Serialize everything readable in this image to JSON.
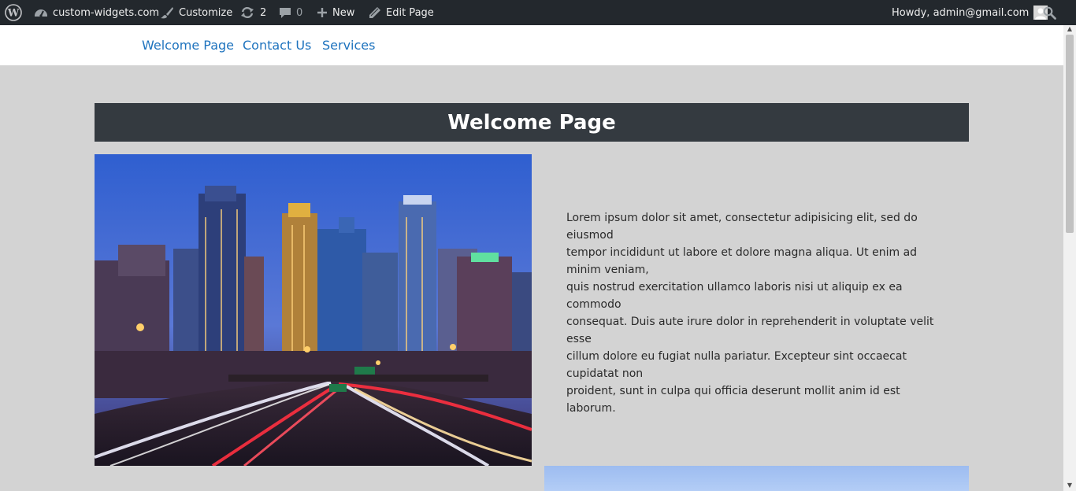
{
  "adminbar": {
    "site_name": "custom-widgets.com",
    "customize": "Customize",
    "updates_count": "2",
    "comments_count": "0",
    "new_label": "New",
    "edit_page": "Edit Page",
    "howdy": "Howdy, admin@gmail.com"
  },
  "nav": {
    "items": [
      {
        "label": "Welcome Page"
      },
      {
        "label": "Contact Us"
      },
      {
        "label": "Services"
      }
    ]
  },
  "main": {
    "title": "Welcome Page",
    "paragraph_lines": [
      "Lorem ipsum dolor sit amet, consectetur adipisicing elit, sed do eiusmod",
      "tempor incididunt ut labore et dolore magna aliqua. Ut enim ad minim veniam,",
      "quis nostrud exercitation ullamco laboris nisi ut aliquip ex ea commodo",
      "consequat. Duis aute irure dolor in reprehenderit in voluptate velit esse",
      "cillum dolore eu fugiat nulla pariatur. Excepteur sint occaecat cupidatat non",
      "proident, sunt in culpa qui officia deserunt mollit anim id est laborum."
    ]
  },
  "colors": {
    "adminbar_bg": "#23282d",
    "title_bar_bg": "#343a40",
    "nav_link": "#1e73be",
    "page_bg": "#d3d3d3"
  },
  "icons": [
    "wordpress-logo-icon",
    "dashboard-icon",
    "brush-icon",
    "updates-icon",
    "comment-icon",
    "plus-icon",
    "pencil-icon",
    "avatar-icon",
    "search-icon"
  ]
}
